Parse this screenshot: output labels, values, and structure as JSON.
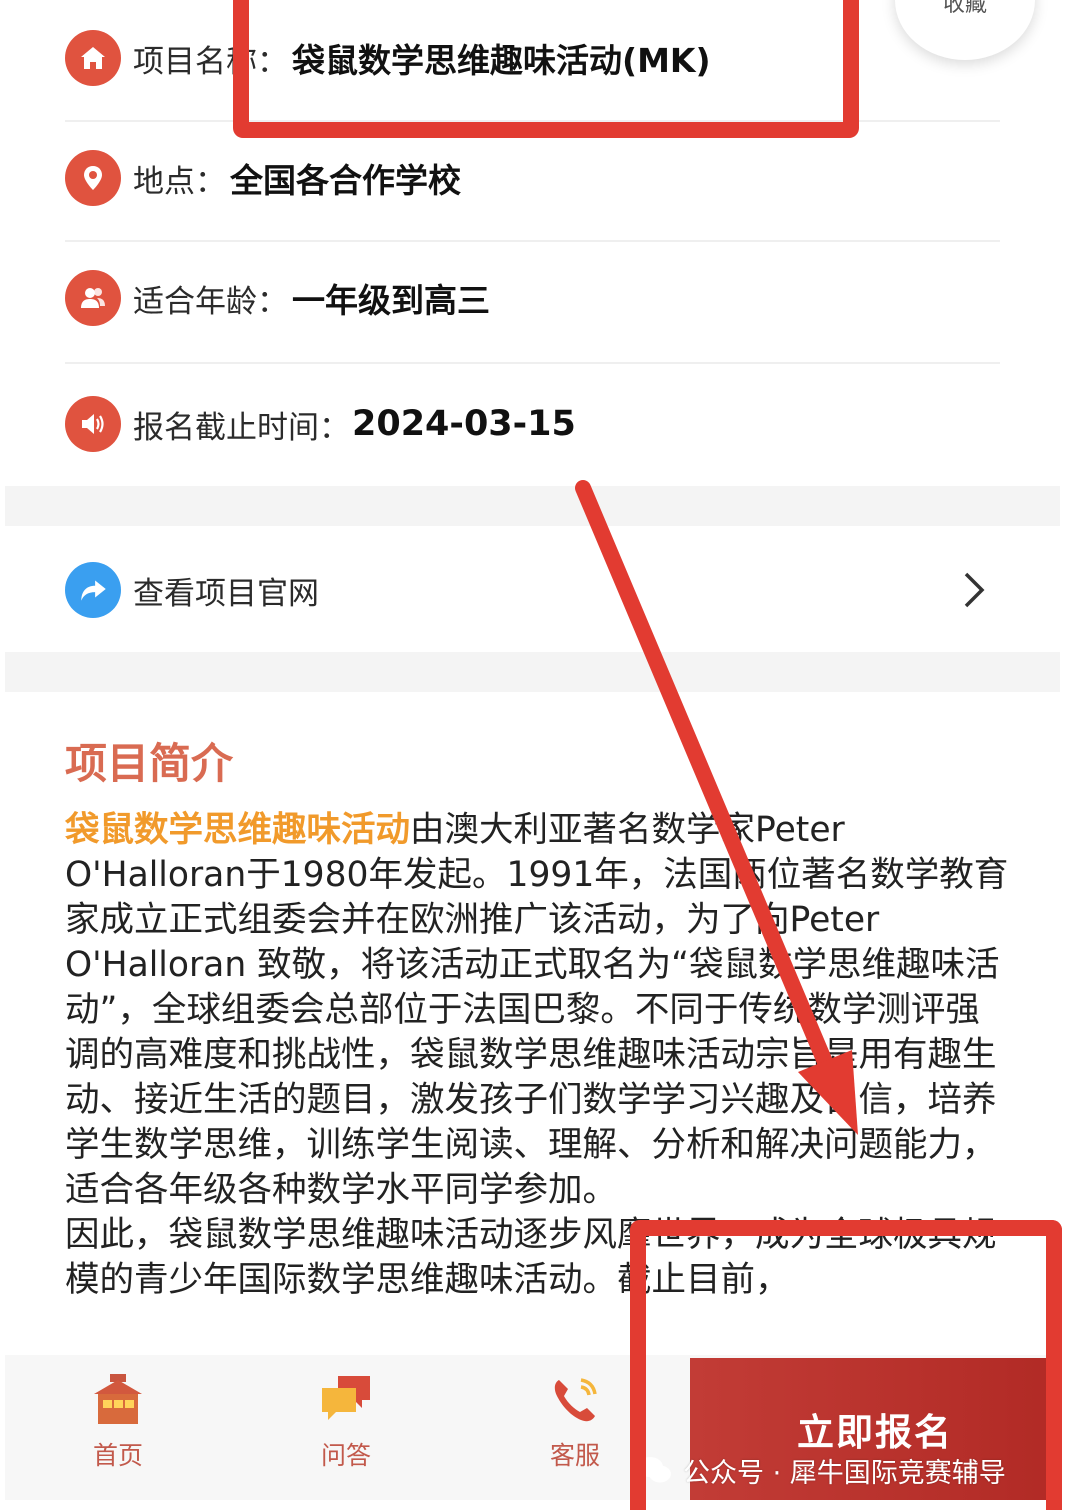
{
  "info": {
    "project": {
      "label": "项目名称：",
      "value": "袋鼠数学思维趣味活动(MK)"
    },
    "location": {
      "label": "地点：",
      "value": "全国各合作学校"
    },
    "age": {
      "label": "适合年龄：",
      "value": "一年级到高三"
    },
    "deadline": {
      "label": "报名截止时间：",
      "value": "2024-03-15"
    }
  },
  "favorite_label": "收藏",
  "website_link": {
    "label": "查看项目官网"
  },
  "intro": {
    "title": "项目简介",
    "highlight": "袋鼠数学思维趣味活动",
    "paragraph1": "由澳大利亚著名数学家Peter O'Halloran于1980年发起。1991年，法国两位著名数学教育家成立正式组委会并在欧洲推广该活动，为了向Peter O'Halloran 致敬，将该活动正式取名为“袋鼠数学思维趣味活动”，全球组委会总部位于法国巴黎。不同于传统数学测评强调的高难度和挑战性，袋鼠数学思维趣味活动宗旨是用有趣生动、接近生活的题目，激发孩子们数学学习兴趣及自信，培养学生数学思维，训练学生阅读、理解、分析和解决问题能力，适合各年级各种数学水平同学参加。",
    "paragraph2": "因此，袋鼠数学思维趣味活动逐步风靡世界，成为全球极具规模的青少年国际数学思维趣味活动。截止目前，"
  },
  "tabs": [
    {
      "label": "首页",
      "icon": "house-icon"
    },
    {
      "label": "问答",
      "icon": "chat-bubbles-icon"
    },
    {
      "label": "客服",
      "icon": "phone-icon"
    }
  ],
  "signup_button": "立即报名",
  "watermark": "公众号 · 犀牛国际竞赛辅导",
  "colors": {
    "accent_red": "#e0533f",
    "annotation_red": "#e23b31",
    "highlight_orange": "#f19a2b",
    "title_coral": "#d96b52",
    "link_blue": "#3a9ff0",
    "button_red": "#b12a25"
  }
}
